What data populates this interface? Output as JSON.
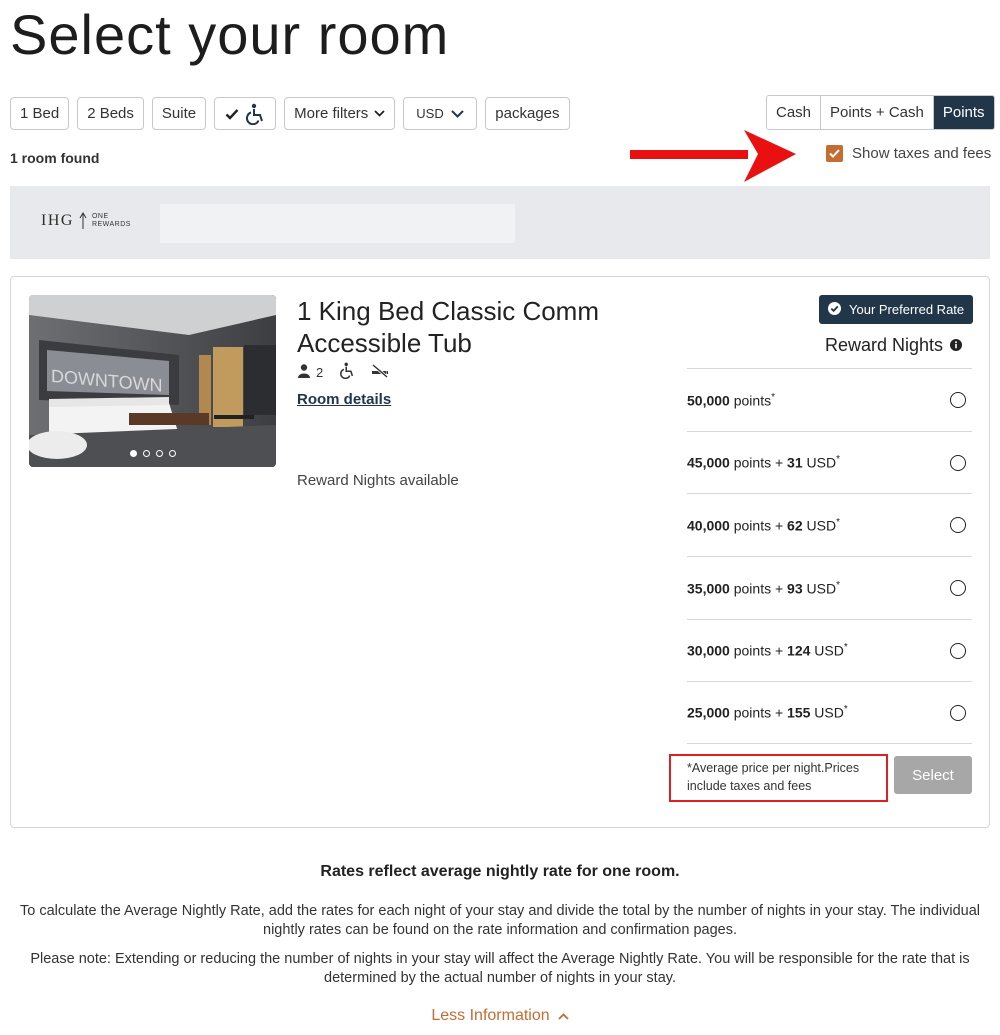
{
  "page": {
    "title": "Select your room"
  },
  "filters": {
    "one_bed": "1 Bed",
    "two_beds": "2 Beds",
    "suite": "Suite",
    "more_filters": "More filters",
    "currency": "USD",
    "packages": "packages",
    "accessible_icon": "wheelchair-icon",
    "checked_icon": "checkmark-icon"
  },
  "payment_toggle": {
    "options": [
      "Cash",
      "Points + Cash",
      "Points"
    ],
    "selected": "Points"
  },
  "results": {
    "count_label": "1 room found"
  },
  "tax_toggle": {
    "label": "Show taxes and fees",
    "checked": true
  },
  "brand": {
    "name": "IHG",
    "sub_line1": "ONE",
    "sub_line2": "REWARDS"
  },
  "room": {
    "name": "1 King Bed Classic Comm Accessible Tub",
    "occupancy": "2",
    "details_link": "Room details",
    "availability": "Reward Nights available",
    "photo_count": 4,
    "photo_active_index": 0,
    "badge": "Your Preferred Rate",
    "rate_heading": "Reward Nights",
    "rates": [
      {
        "points": "50,000",
        "points_word": "points",
        "cash": "",
        "currency": ""
      },
      {
        "points": "45,000",
        "points_word": "points +",
        "cash": "31",
        "currency": "USD"
      },
      {
        "points": "40,000",
        "points_word": "points +",
        "cash": "62",
        "currency": "USD"
      },
      {
        "points": "35,000",
        "points_word": "points +",
        "cash": "93",
        "currency": "USD"
      },
      {
        "points": "30,000",
        "points_word": "points +",
        "cash": "124",
        "currency": "USD"
      },
      {
        "points": "25,000",
        "points_word": "points +",
        "cash": "155",
        "currency": "USD"
      }
    ],
    "asterisk": "*",
    "note": "*Average price per night.Prices include taxes and fees",
    "select_label": "Select"
  },
  "info": {
    "heading": "Rates reflect average nightly rate for one room.",
    "paragraph1": "To calculate the Average Nightly Rate, add the rates for each night of your stay and divide the total by the number of nights in your stay. The individual nightly rates can be found on the rate information and confirmation pages.",
    "paragraph2": "Please note: Extending or reducing the number of nights in your stay will affect the Average Nightly Rate. You will be responsible for the rate that is determined by the actual number of nights in your stay.",
    "toggle_label": "Less Information"
  },
  "colors": {
    "navy": "#22364a",
    "accent": "#c56c33",
    "annotation_red": "#e02020",
    "disabled": "#a7a7a7"
  }
}
